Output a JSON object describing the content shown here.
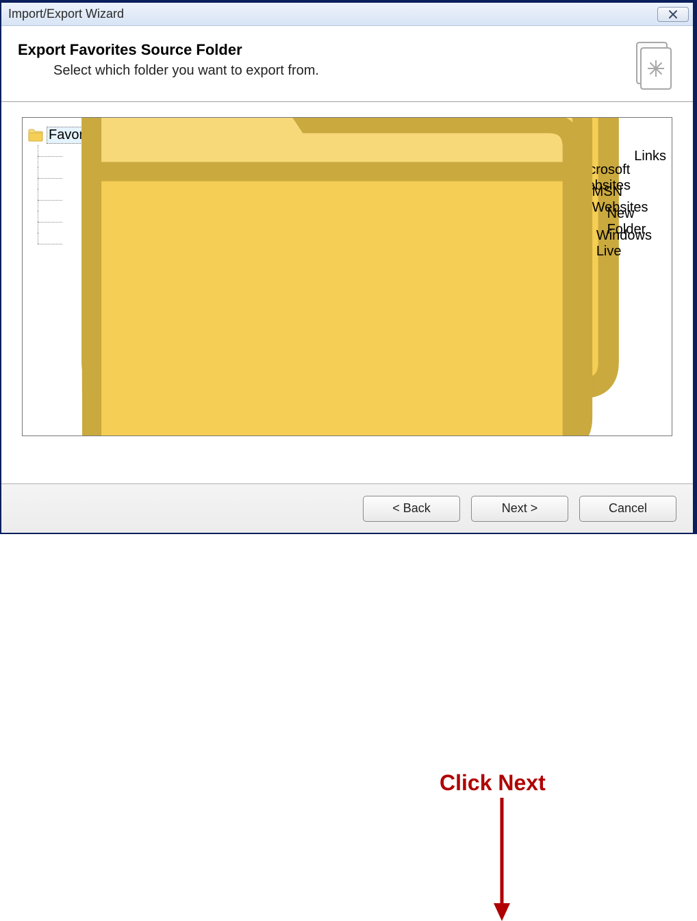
{
  "window": {
    "title": "Import/Export Wizard"
  },
  "header": {
    "title": "Export Favorites Source Folder",
    "subtitle": "Select which folder you want to export from."
  },
  "tree": {
    "root": "Favorites",
    "children": [
      "Links",
      "Microsoft Websites",
      "MSN Websites",
      "New Folder",
      "Windows Live"
    ]
  },
  "buttons": {
    "back": "< Back",
    "next": "Next >",
    "cancel": "Cancel"
  },
  "annotation": {
    "text": "Click Next"
  }
}
